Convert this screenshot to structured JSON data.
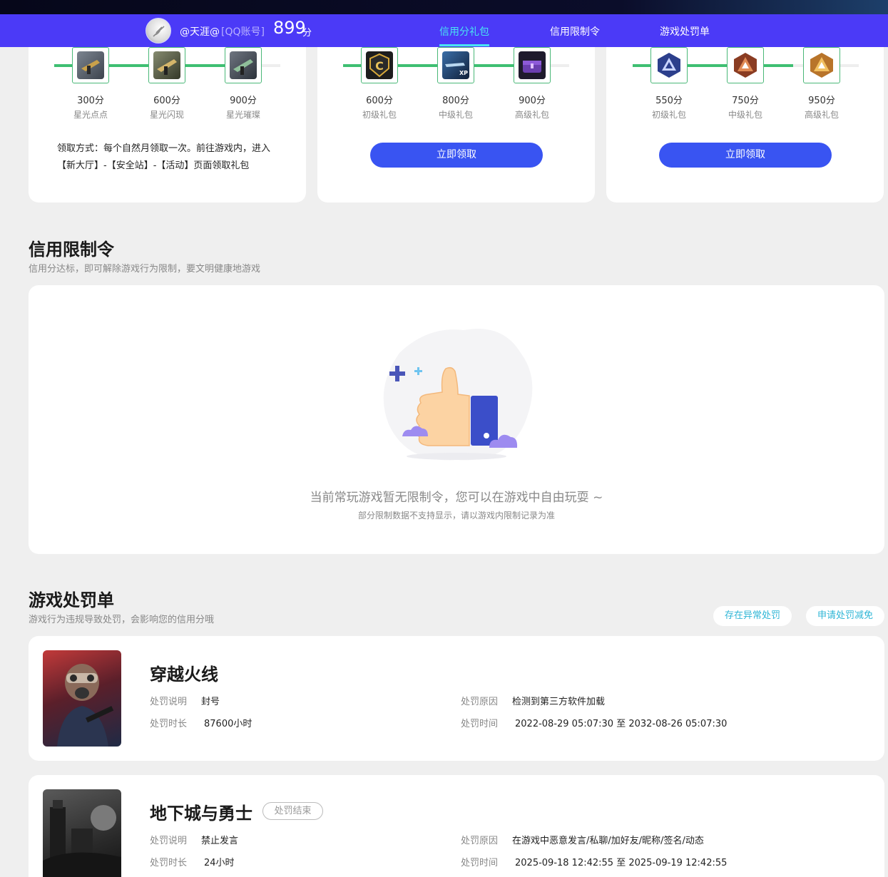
{
  "header": {
    "username": "@天涯@",
    "account_type": "[QQ账号]",
    "score": "899",
    "score_unit": "分",
    "nav": [
      "信用分礼包",
      "信用限制令",
      "游戏处罚单"
    ]
  },
  "gift_cards": [
    {
      "gifts": [
        {
          "points": "300分",
          "name": "星光点点",
          "icon": "gun-skin-icon"
        },
        {
          "points": "600分",
          "name": "星光闪现",
          "icon": "gun-skin-icon"
        },
        {
          "points": "900分",
          "name": "星光璀璨",
          "icon": "gun-skin-icon"
        }
      ],
      "note": "领取方式：每个自然月领取一次。前往游戏内，进入【新大厅】-【安全站】-【活动】页面领取礼包"
    },
    {
      "gifts": [
        {
          "points": "600分",
          "name": "初级礼包",
          "icon": "shield-c-icon"
        },
        {
          "points": "800分",
          "name": "中级礼包",
          "icon": "xp-card-icon"
        },
        {
          "points": "900分",
          "name": "高级礼包",
          "icon": "chest-icon"
        }
      ],
      "button": "立即领取"
    },
    {
      "gifts": [
        {
          "points": "550分",
          "name": "初级礼包",
          "icon": "blue-emblem-icon"
        },
        {
          "points": "750分",
          "name": "中级礼包",
          "icon": "bronze-emblem-icon"
        },
        {
          "points": "950分",
          "name": "高级礼包",
          "icon": "gold-emblem-icon"
        }
      ],
      "button": "立即领取"
    }
  ],
  "restriction": {
    "title": "信用限制令",
    "subtitle": "信用分达标，即可解除游戏行为限制，要文明健康地游戏",
    "empty_main": "当前常玩游戏暂无限制令，您可以在游戏中自由玩耍 ~",
    "empty_sub": "部分限制数据不支持显示，请以游戏内限制记录为准"
  },
  "penalty": {
    "title": "游戏处罚单",
    "subtitle": "游戏行为违规导致处罚，会影响您的信用分哦",
    "actions": [
      "存在异常处罚",
      "申请处罚减免"
    ],
    "labels": {
      "desc": "处罚说明",
      "duration": "处罚时长",
      "reason": "处罚原因",
      "time": "处罚时间"
    },
    "items": [
      {
        "game": "穿越火线",
        "status": "",
        "desc": "封号",
        "duration": "87600小时",
        "reason": "检测到第三方软件加载",
        "time": "2022-08-29 05:07:30 至 2032-08-26 05:07:30"
      },
      {
        "game": "地下城与勇士",
        "status": "处罚结束",
        "desc": "禁止发言",
        "duration": "24小时",
        "reason": "在游戏中恶意发言/私聊/加好友/昵称/签名/动态",
        "time": "2025-09-18 12:42:55 至 2025-09-19 12:42:55"
      }
    ]
  },
  "colors": {
    "header": "#4b3af7",
    "active_tab": "#49e4f2",
    "button": "#3954f2",
    "track": "#3fbf72"
  }
}
